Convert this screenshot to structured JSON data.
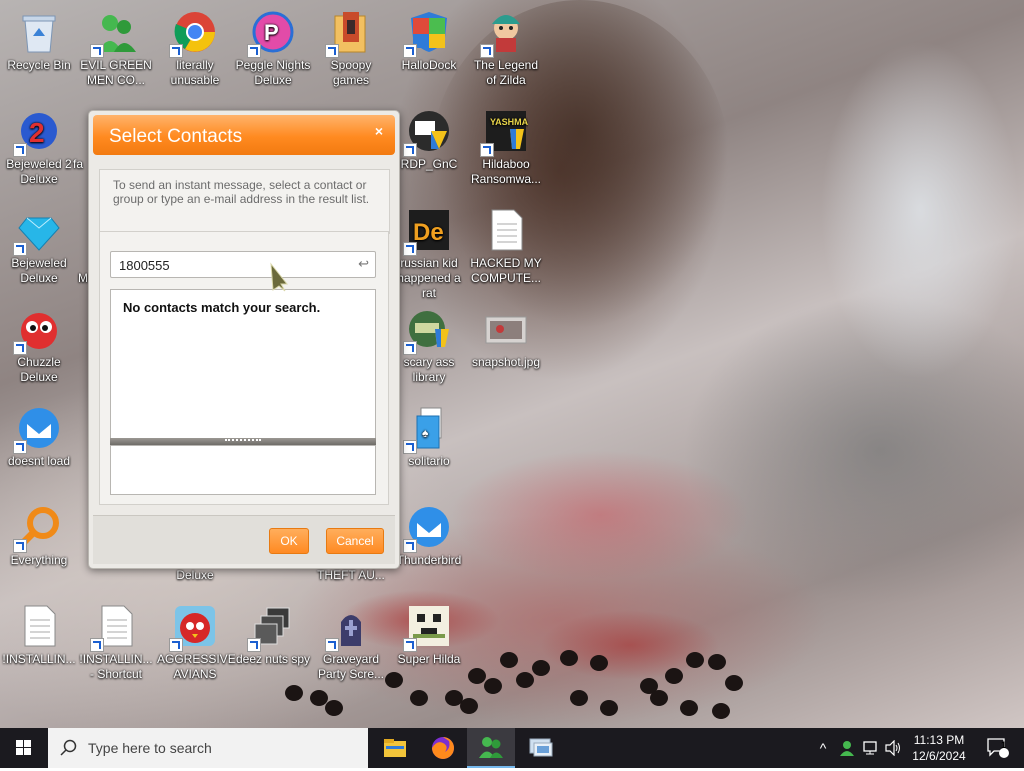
{
  "desktop": {
    "icons": [
      {
        "id": "recycle-bin",
        "label": "Recycle Bin",
        "icon": "recycle-bin-icon",
        "color": "#9fb8d6"
      },
      {
        "id": "evil-green-men",
        "label": "EVIL GREEN MEN CO...",
        "icon": "green-men-icon",
        "color": "#3da84a"
      },
      {
        "id": "literally-unusable",
        "label": "literally unusable",
        "icon": "chrome-icon",
        "color": "#db4437"
      },
      {
        "id": "peggle-nights",
        "label": "Peggle Nights Deluxe",
        "icon": "peggle-icon",
        "color": "#d8399a"
      },
      {
        "id": "spoopy-games",
        "label": "Spoopy games",
        "icon": "folder-icon",
        "color": "#e8b64a"
      },
      {
        "id": "hallodock",
        "label": "HalloDock",
        "icon": "shield-icon",
        "color": "#2f7bd8"
      },
      {
        "id": "legend-of-zilda",
        "label": "The Legend of Zilda",
        "icon": "zilda-icon",
        "color": "#2c9c8e"
      },
      {
        "id": "bejeweled-2",
        "label": "Bejeweled 2 Deluxe",
        "icon": "bejeweled2-icon",
        "color": "#2a5ad0"
      },
      {
        "id": "fa-partial",
        "label": "fa",
        "icon": "partial-icon",
        "color": "#888888"
      },
      {
        "id": "rdp-gnc",
        "label": "RDP_GnC",
        "icon": "rdp-icon",
        "color": "#2b2b2b"
      },
      {
        "id": "hildaboo",
        "label": "Hildaboo Ransomwa...",
        "icon": "yashma-icon",
        "color": "#1d1d1d"
      },
      {
        "id": "bejeweled",
        "label": "Bejeweled Deluxe",
        "icon": "gem-icon",
        "color": "#27b6e8"
      },
      {
        "id": "m-partial",
        "label": "M",
        "icon": "partial-icon",
        "color": "#888888"
      },
      {
        "id": "russian-kid",
        "label": "russian kid happened a rat",
        "icon": "de-icon",
        "color": "#f0a020"
      },
      {
        "id": "hacked-my-computer",
        "label": "HACKED MY COMPUTE...",
        "icon": "document-icon",
        "color": "#ffffff"
      },
      {
        "id": "chuzzle",
        "label": "Chuzzle Deluxe",
        "icon": "chuzzle-icon",
        "color": "#e02f2f"
      },
      {
        "id": "scary-ass-library",
        "label": "scary ass library",
        "icon": "library-icon",
        "color": "#3f7f3f"
      },
      {
        "id": "snapshot",
        "label": "snapshot.jpg",
        "icon": "image-icon",
        "color": "#d0d0d0"
      },
      {
        "id": "doesnt-load",
        "label": "doesnt load",
        "icon": "thunderbird-icon",
        "color": "#2f8fe8"
      },
      {
        "id": "solitario",
        "label": "solitario",
        "icon": "cards-icon",
        "color": "#3aa0e8"
      },
      {
        "id": "everything",
        "label": "Everything",
        "icon": "magnifier-icon",
        "color": "#f08a18"
      },
      {
        "id": "thunderbird",
        "label": "Thunderbird",
        "icon": "thunderbird-icon",
        "color": "#2f8fe8"
      },
      {
        "id": "deluxe-partial",
        "label": "Deluxe",
        "icon": "partial-icon",
        "color": "#888888"
      },
      {
        "id": "theft-au",
        "label": "THEFT AU...",
        "icon": "partial-icon",
        "color": "#888888"
      },
      {
        "id": "installing-1",
        "label": "!INSTALLIN...",
        "icon": "document-icon",
        "color": "#ffffff"
      },
      {
        "id": "installing-2",
        "label": "!INSTALLIN... - Shortcut",
        "icon": "document-icon",
        "color": "#ffffff"
      },
      {
        "id": "aggressive-avians",
        "label": "AGGRESSIVE AVIANS",
        "icon": "angry-bird-icon",
        "color": "#d62828"
      },
      {
        "id": "deez-nuts-spy",
        "label": "deez nuts spy",
        "icon": "windows-stack-icon",
        "color": "#555555"
      },
      {
        "id": "graveyard-party",
        "label": "Graveyard Party Scre...",
        "icon": "graveyard-icon",
        "color": "#3c3c6a"
      },
      {
        "id": "super-hilda",
        "label": "Super Hilda",
        "icon": "pixel-dog-icon",
        "color": "#f3efe0"
      }
    ]
  },
  "dialog": {
    "title": "Select Contacts",
    "close_label": "×",
    "instructions": "To send an instant message, select a contact or group or type an e-mail address in the result list.",
    "search_value": "1800555",
    "clear_icon": "↩",
    "result_message": "No contacts match your search.",
    "ok_label": "OK",
    "cancel_label": "Cancel",
    "accent": "#ff8a20"
  },
  "taskbar": {
    "search_placeholder": "Type here to search",
    "apps": [
      "file-explorer-icon",
      "firefox-icon",
      "messenger-icon",
      "remote-desktop-icon"
    ],
    "tray": {
      "chevron": "^",
      "time": "11:13 PM",
      "date": "12/6/2024",
      "notification_count": "1"
    }
  }
}
